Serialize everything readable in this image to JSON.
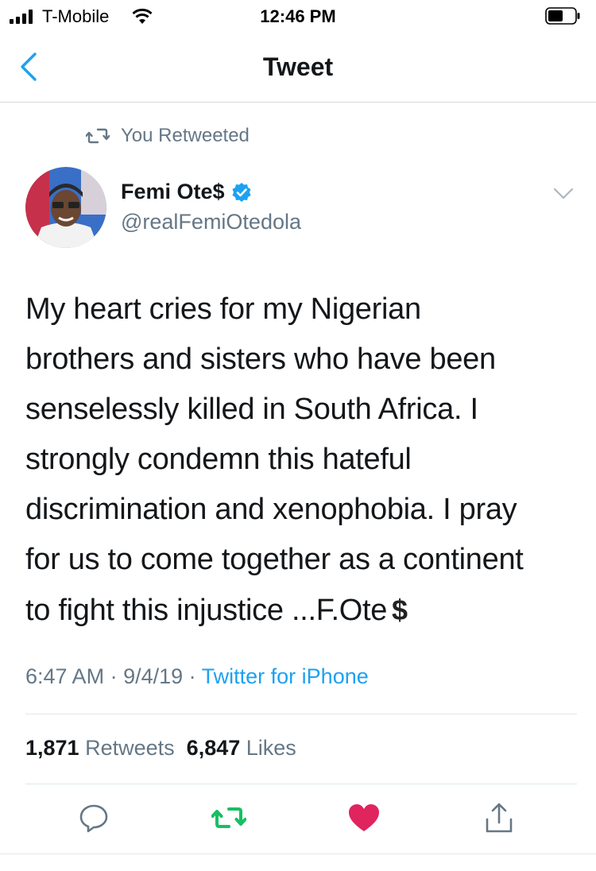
{
  "status_bar": {
    "carrier": "T-Mobile",
    "time": "12:46 PM",
    "icons": [
      "signal-icon",
      "wifi-icon",
      "battery-icon"
    ]
  },
  "nav": {
    "title": "Tweet",
    "back_icon": "chevron-left-icon"
  },
  "retweet_banner": {
    "icon": "retweet-icon",
    "text": "You Retweeted"
  },
  "author": {
    "name": "Femi Ote$",
    "handle": "@realFemiOtedola",
    "verified": true,
    "more_icon": "chevron-down-icon"
  },
  "tweet": {
    "lines": [
      "My heart cries for my Nigerian",
      "brothers and sisters who have been",
      "senselessly killed in South Africa. I",
      "strongly condemn this hateful",
      "discrimination and xenophobia. I pray",
      "for us to come together as a continent",
      "to fight this injustice ...F.Ote"
    ],
    "emoji": "$"
  },
  "meta": {
    "time": "6:47 AM",
    "separator": " · ",
    "date": "9/4/19",
    "source": "Twitter for iPhone"
  },
  "stats": {
    "retweets_count": "1,871",
    "retweets_label": "Retweets",
    "likes_count": "6,847",
    "likes_label": "Likes"
  },
  "actions": [
    {
      "name": "reply",
      "icon": "reply-icon"
    },
    {
      "name": "retweet",
      "icon": "retweet-icon",
      "color": "#17bf63"
    },
    {
      "name": "like",
      "icon": "heart-icon",
      "color": "#e0245e"
    },
    {
      "name": "share",
      "icon": "share-icon"
    }
  ],
  "colors": {
    "link": "#1da1f2",
    "secondary_text": "#657786",
    "retweet_active": "#17bf63",
    "like_active": "#e0245e"
  }
}
